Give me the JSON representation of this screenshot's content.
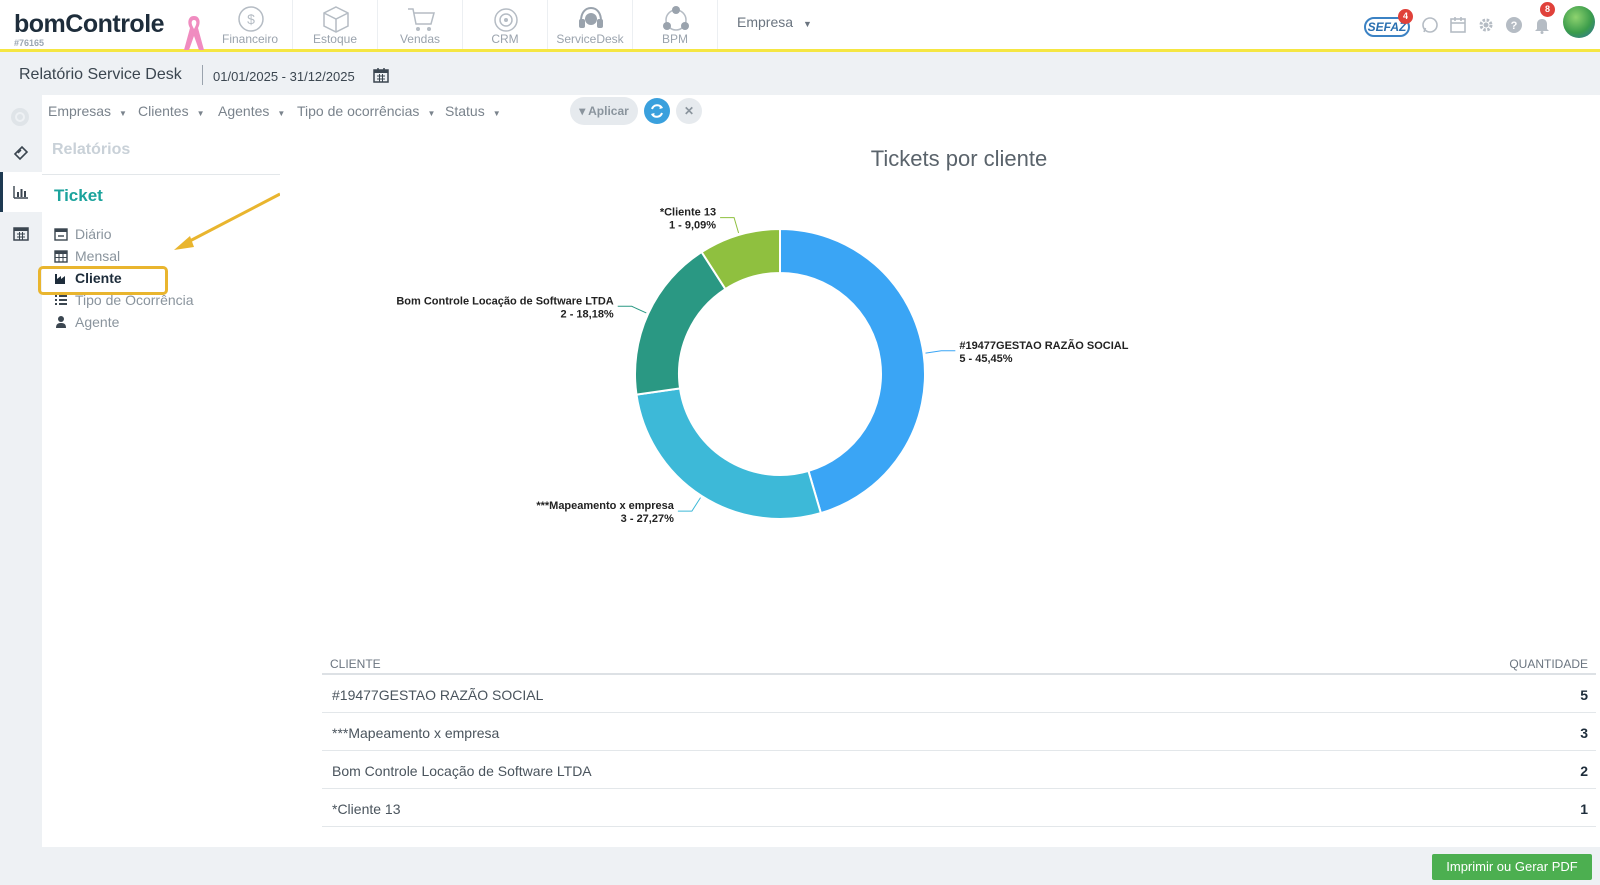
{
  "brand": {
    "logo": "bomControle",
    "account_id": "#76165"
  },
  "modules": [
    {
      "label": "Financeiro",
      "icon": "dollar-icon"
    },
    {
      "label": "Estoque",
      "icon": "box-icon"
    },
    {
      "label": "Vendas",
      "icon": "cart-icon"
    },
    {
      "label": "CRM",
      "icon": "target-icon"
    },
    {
      "label": "ServiceDesk",
      "icon": "headset-icon"
    },
    {
      "label": "BPM",
      "icon": "workflow-icon"
    }
  ],
  "company_menu": {
    "label": "Empresa"
  },
  "header_icons": {
    "sefaz_label": "SEFAZ",
    "sefaz_count": "4",
    "notifications_count": "8"
  },
  "page": {
    "title": "Relatório Service Desk",
    "date_range": "01/01/2025 - 31/12/2025"
  },
  "filters": {
    "empresas": "Empresas",
    "clientes": "Clientes",
    "agentes": "Agentes",
    "tipo": "Tipo de ocorrências",
    "status": "Status",
    "apply": "Aplicar"
  },
  "sidebar": {
    "heading": "Relatórios",
    "section": "Ticket",
    "items": [
      {
        "label": "Diário",
        "icon": "calendar-icon"
      },
      {
        "label": "Mensal",
        "icon": "calendar-grid-icon"
      },
      {
        "label": "Cliente",
        "icon": "factory-icon",
        "active": true
      },
      {
        "label": "Tipo de Ocorrência",
        "icon": "list-icon"
      },
      {
        "label": "Agente",
        "icon": "user-icon"
      }
    ]
  },
  "chart_data": {
    "type": "pie",
    "title": "Tickets por cliente",
    "donut": true,
    "slices": [
      {
        "label": "#19477GESTAO RAZÃO SOCIAL",
        "value": 5,
        "pct_label": "5 - 45,45%",
        "color": "#3aa5f5"
      },
      {
        "label": "***Mapeamento x empresa",
        "value": 3,
        "pct_label": "3 - 27,27%",
        "color": "#3db9d8"
      },
      {
        "label": "Bom Controle Locação de Software LTDA",
        "value": 2,
        "pct_label": "2 - 18,18%",
        "color": "#2a9883"
      },
      {
        "label": "*Cliente 13",
        "value": 1,
        "pct_label": "1 - 9,09%",
        "color": "#8fc03f"
      }
    ]
  },
  "table": {
    "headers": {
      "client": "CLIENTE",
      "qty": "QUANTIDADE"
    },
    "rows": [
      {
        "client": "#19477GESTAO RAZÃO SOCIAL",
        "qty": "5"
      },
      {
        "client": "***Mapeamento x empresa",
        "qty": "3"
      },
      {
        "client": "Bom Controle Locação de Software LTDA",
        "qty": "2"
      },
      {
        "client": "*Cliente 13",
        "qty": "1"
      }
    ]
  },
  "footer": {
    "pdf_button": "Imprimir ou Gerar PDF"
  }
}
